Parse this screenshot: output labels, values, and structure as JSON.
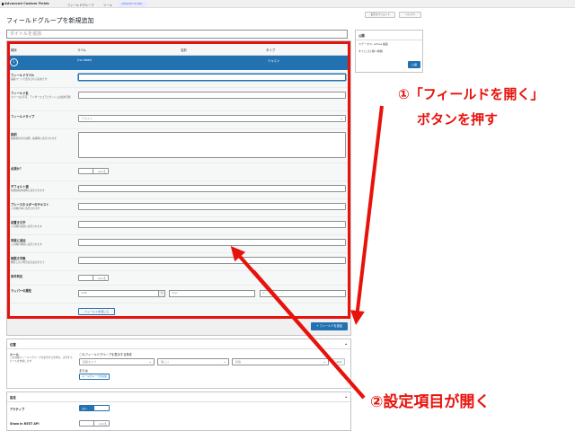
{
  "topbar": {
    "brand": "Advanced Custom Fields",
    "nav_field_groups": "フィールドグループ",
    "nav_tools": "ツール",
    "upgrade": "UPGRADE TO PRO"
  },
  "screen_options": "表示オプション ▾",
  "help": "ヘルプ ▾",
  "page_title": "フィールドグループを新規追加",
  "title_input": {
    "placeholder": "タイトルを追加"
  },
  "field_table": {
    "headers": [
      "順序",
      "ラベル",
      "名前",
      "タイプ"
    ],
    "active_row": {
      "order": "1",
      "label": "(no label)",
      "type": "テキスト"
    }
  },
  "settings": {
    "field_label": {
      "label": "フィールドラベル",
      "desc": "編集ページで表示される名前です"
    },
    "field_name": {
      "label": "フィールド名",
      "desc": "スペースは不可、アンダースコアとダッシュは使用可能"
    },
    "field_type": {
      "label": "フィールドタイプ",
      "value": "テキスト"
    },
    "instructions": {
      "label": "説明",
      "desc": "投稿者向けの説明。編集時に表示されます"
    },
    "required": {
      "label": "必須か？",
      "toggle": "いいえ"
    },
    "default_value": {
      "label": "デフォルト値",
      "desc": "新規投稿作成時に表示されます"
    },
    "placeholder": {
      "label": "プレースホルダーのテキスト",
      "desc": "入力欄の中に表示されます"
    },
    "prepend": {
      "label": "前置き文字",
      "desc": "入力欄の先頭に表示されます"
    },
    "append": {
      "label": "末尾に追加",
      "desc": "入力欄の末尾に表示されます"
    },
    "max_length": {
      "label": "制限文字数",
      "desc": "制限しない場合は空白のままで"
    },
    "conditional_logic": {
      "label": "条件判定",
      "toggle": "いいえ"
    },
    "wrapper": {
      "label": "ラッパーの属性",
      "width": "width",
      "unit": "%",
      "class": "class",
      "id": "id"
    },
    "close_field": "フィールドを閉じる"
  },
  "add_field_button": "+ フィールドを追加",
  "publish_box": {
    "title": "公開",
    "status": "ステータス: active 編集",
    "trash": "すぐにゴミ箱へ移動",
    "publish_button": "公開"
  },
  "location_section": {
    "title": "位置",
    "rules_label": "ルール",
    "rules_desc": "この詳細フィールドグループを表示する条件を、実行するルールを作成します",
    "show_if": "このフィールドグループを表示する条件",
    "select_param": "投稿タイプ",
    "select_operator": "等しい",
    "select_value": "投稿",
    "and_button": "and",
    "or_label": "または",
    "add_rule_group": "ルールグループを追加"
  },
  "settings_section": {
    "title": "設定",
    "active_label": "アクティブ",
    "active_toggle": "はい",
    "rest_label": "Show in REST API",
    "rest_toggle": "いいえ"
  },
  "annotations": {
    "step1_line1": "①「フィールドを開く」",
    "step1_line2": "ボタンを押す",
    "step2": "②設定項目が開く",
    "color": "#e8120c"
  }
}
